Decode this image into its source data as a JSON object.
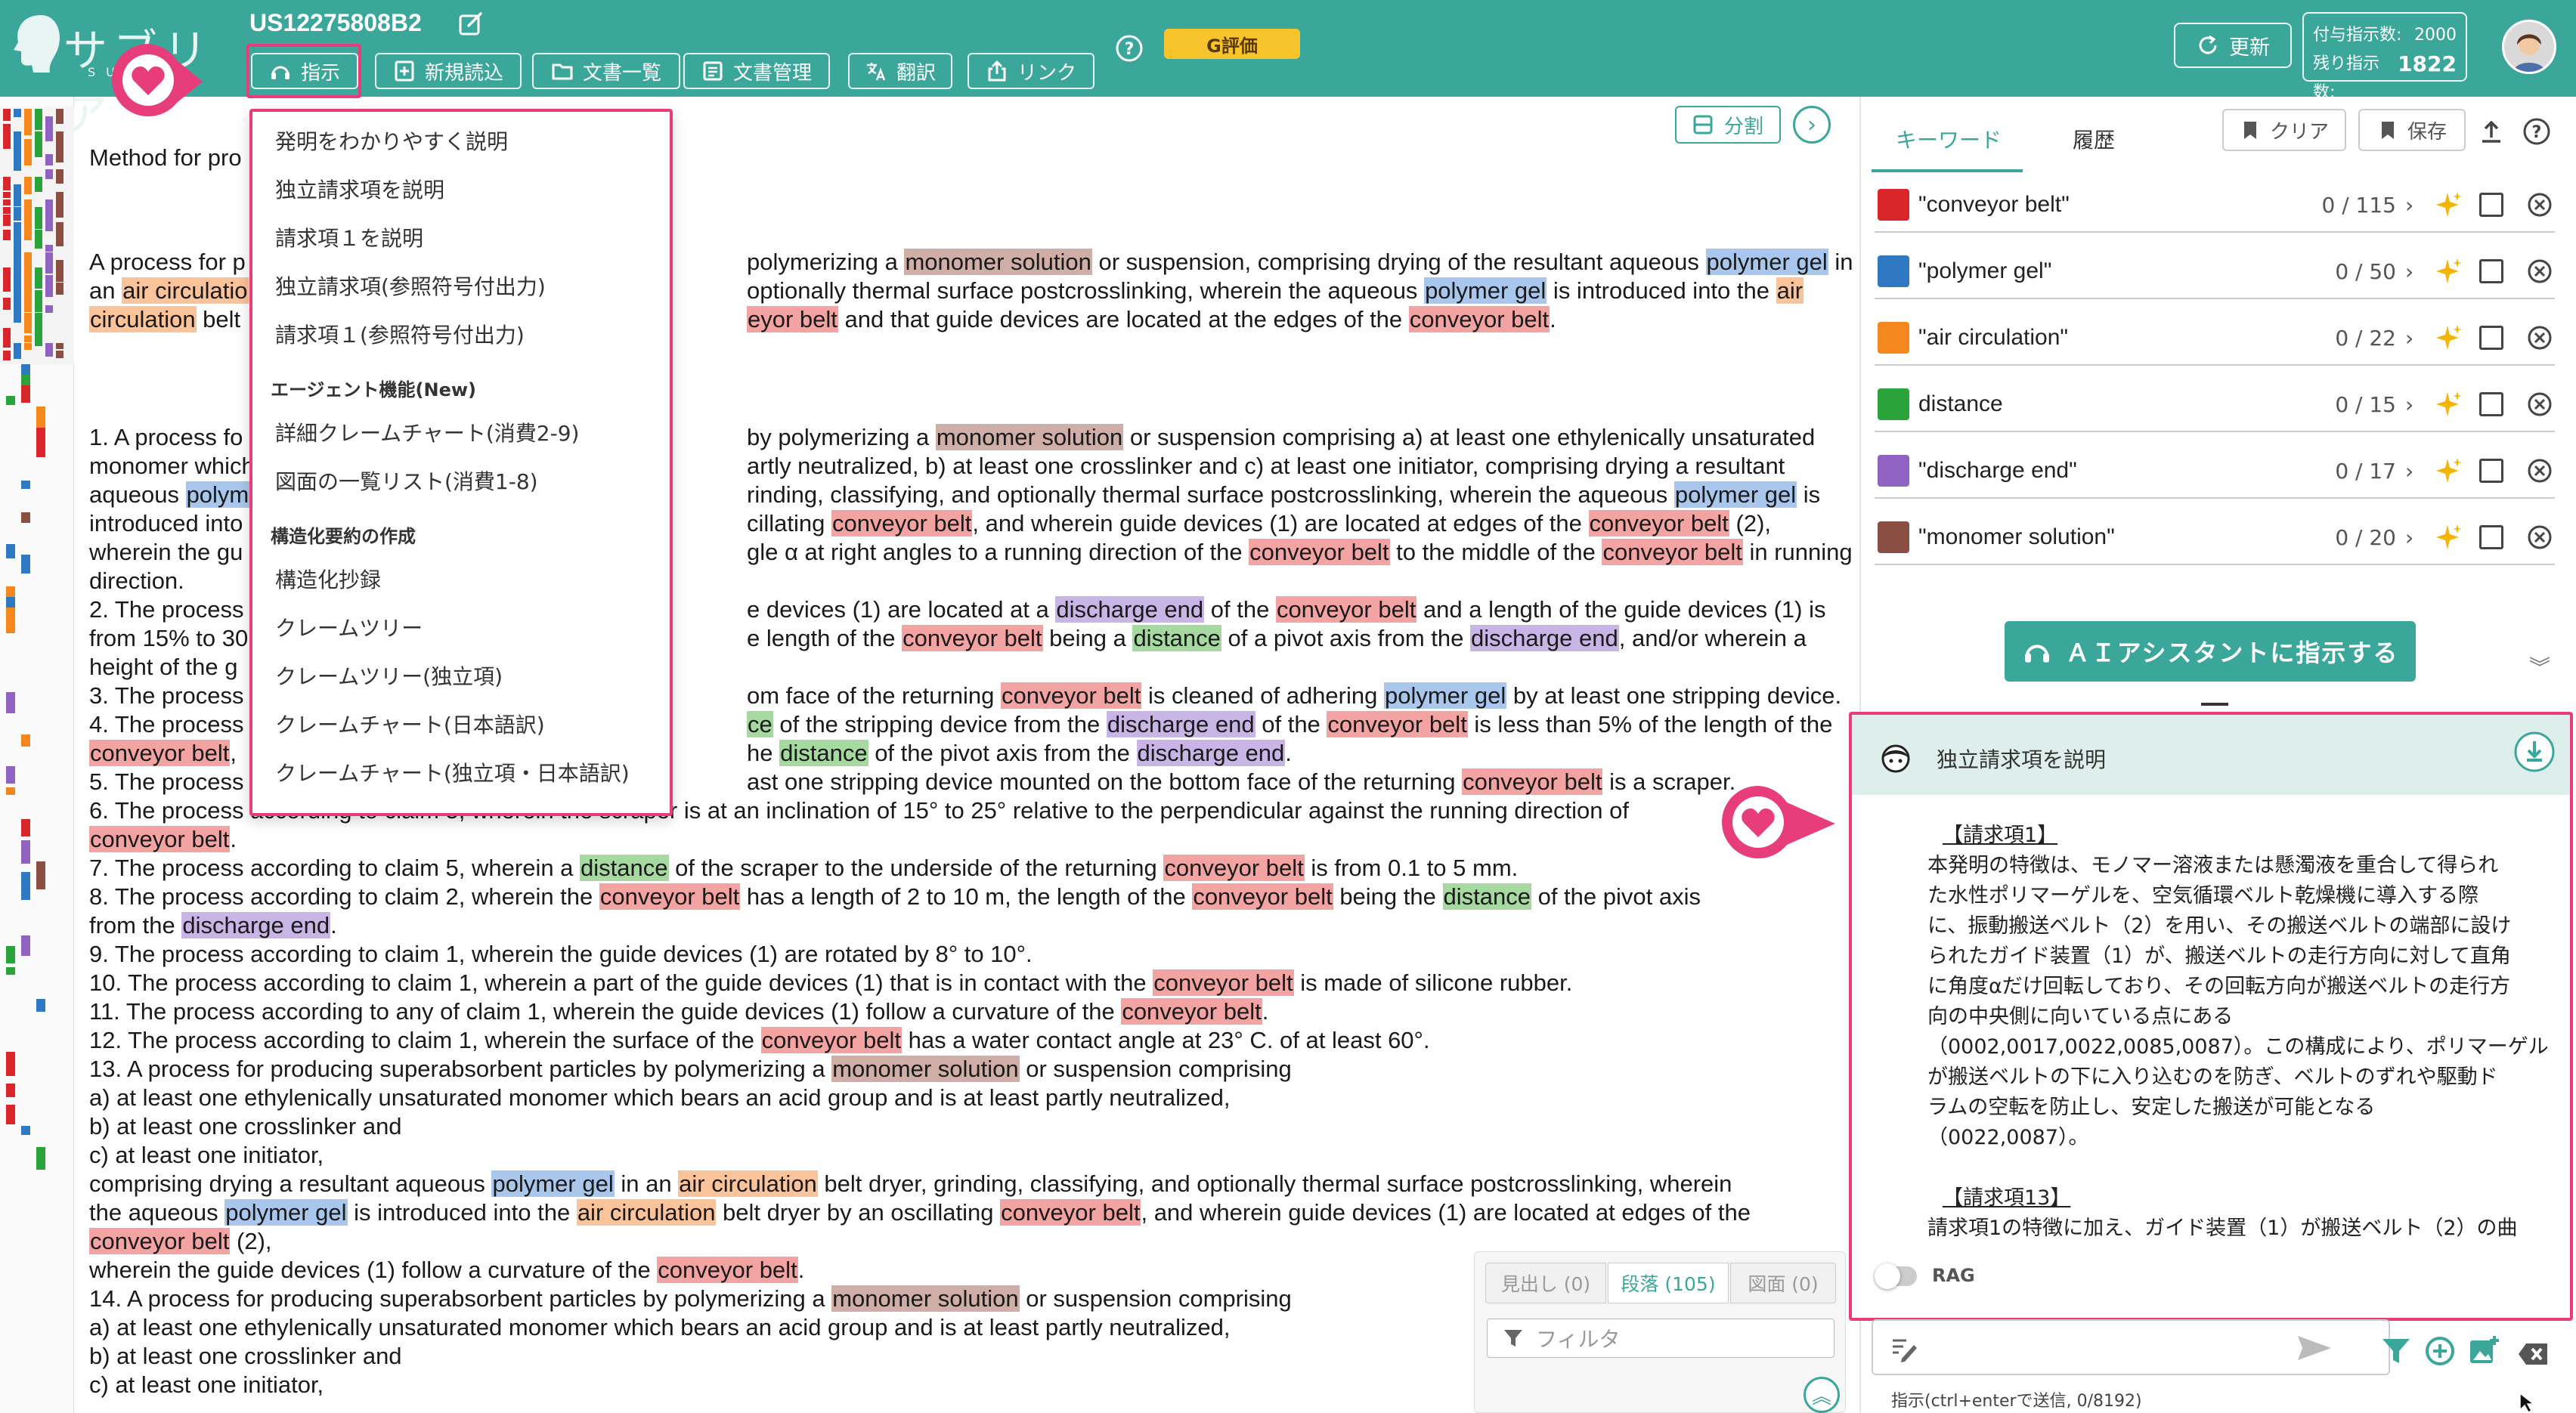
{
  "header": {
    "logo_text": "サブリア",
    "logo_sub": "SUBLIA",
    "doc_id": "US12275808B2",
    "buttons": [
      {
        "label": "指示",
        "icon": "assistant-icon"
      },
      {
        "label": "新規読込",
        "icon": "add-document-icon"
      },
      {
        "label": "文書一覧",
        "icon": "folder-icon"
      },
      {
        "label": "文書管理",
        "icon": "manage-icon"
      },
      {
        "label": "翻訳",
        "icon": "translate-icon"
      },
      {
        "label": "リンク",
        "icon": "share-icon"
      }
    ],
    "eval_badge": "G評価",
    "refresh_label": "更新",
    "quota_granted_label": "付与指示数:",
    "quota_granted": "2000",
    "quota_remaining_label": "残り指示数:",
    "quota_remaining": "1822"
  },
  "dropdown": {
    "items": [
      "発明をわかりやすく説明",
      "独立請求項を説明",
      "請求項１を説明",
      "独立請求項(参照符号付出力)",
      "請求項１(参照符号付出力)"
    ],
    "agent_header": "エージェント機能(New)",
    "agent_items": [
      "詳細クレームチャート(消費2-9)",
      "図面の一覧リスト(消費1-8)"
    ],
    "struct_header": "構造化要約の作成",
    "struct_items": [
      "構造化抄録",
      "クレームツリー",
      "クレームツリー(独立項)",
      "クレームチャート(日本語訳)",
      "クレームチャート(独立項・日本語訳)"
    ]
  },
  "document": {
    "split_label": "分割",
    "lines": [
      [
        {
          "t": "Method for pro"
        }
      ],
      [
        {
          "t": "A process for p"
        },
        {
          "gap": true
        },
        {
          "t": "polymerizing a "
        },
        {
          "t": "monomer solution",
          "k": "brown"
        },
        {
          "t": " or suspension, comprising drying of the resultant aqueous "
        },
        {
          "t": "polymer gel",
          "k": "blue"
        },
        {
          "t": " in"
        }
      ],
      [
        {
          "t": "an "
        },
        {
          "t": "air circulatio",
          "k": "orange"
        },
        {
          "gap": true
        },
        {
          "t": "optionally thermal surface postcrosslinking, wherein the aqueous "
        },
        {
          "t": "polymer gel",
          "k": "blue"
        },
        {
          "t": " is introduced into the "
        },
        {
          "t": "air",
          "k": "orange"
        }
      ],
      [
        {
          "t": "circulation",
          "k": "orange"
        },
        {
          "t": " belt"
        },
        {
          "gap": true
        },
        {
          "t": "eyor belt",
          "k": "red"
        },
        {
          "t": " and that guide devices are located at the edges of the "
        },
        {
          "t": "conveyor belt",
          "k": "red"
        },
        {
          "t": "."
        }
      ],
      [
        {
          "t": "1. A process fo"
        },
        {
          "gap": true
        },
        {
          "t": "by polymerizing a "
        },
        {
          "t": "monomer solution",
          "k": "brown"
        },
        {
          "t": " or suspension comprising a) at least one ethylenically unsaturated"
        }
      ],
      [
        {
          "t": "monomer which"
        },
        {
          "gap": true
        },
        {
          "t": "artly neutralized, b) at least one crosslinker and c) at least one initiator, comprising drying a resultant"
        }
      ],
      [
        {
          "t": "aqueous "
        },
        {
          "t": "polym",
          "k": "blue"
        },
        {
          "gap": true
        },
        {
          "t": "rinding, classifying, and optionally thermal surface postcrosslinking, wherein the aqueous "
        },
        {
          "t": "polymer gel",
          "k": "blue"
        },
        {
          "t": " is"
        }
      ],
      [
        {
          "t": "introduced into"
        },
        {
          "gap": true
        },
        {
          "t": "cillating "
        },
        {
          "t": "conveyor belt",
          "k": "red"
        },
        {
          "t": ", and wherein guide devices (1) are located at edges of the "
        },
        {
          "t": "conveyor belt",
          "k": "red"
        },
        {
          "t": " (2),"
        }
      ],
      [
        {
          "t": "wherein the gu"
        },
        {
          "gap": true
        },
        {
          "t": "gle α at right angles to a running direction of the "
        },
        {
          "t": "conveyor belt",
          "k": "red"
        },
        {
          "t": " to the middle of the "
        },
        {
          "t": "conveyor belt",
          "k": "red"
        },
        {
          "t": " in running"
        }
      ],
      [
        {
          "t": "direction."
        }
      ],
      [
        {
          "t": "2. The process"
        },
        {
          "gap": true
        },
        {
          "t": "e devices (1) are located at a "
        },
        {
          "t": "discharge end",
          "k": "purple"
        },
        {
          "t": " of the "
        },
        {
          "t": "conveyor belt",
          "k": "red"
        },
        {
          "t": " and a length of the guide devices (1) is"
        }
      ],
      [
        {
          "t": "from 15% to 30"
        },
        {
          "gap": true
        },
        {
          "t": "e length of the "
        },
        {
          "t": "conveyor belt",
          "k": "red"
        },
        {
          "t": " being a "
        },
        {
          "t": "distance",
          "k": "green"
        },
        {
          "t": " of a pivot axis from the "
        },
        {
          "t": "discharge end",
          "k": "purple"
        },
        {
          "t": ", and/or wherein a"
        }
      ],
      [
        {
          "t": "height of the g"
        }
      ],
      [
        {
          "t": "3. The process"
        },
        {
          "gap": true
        },
        {
          "t": "om face of the returning "
        },
        {
          "t": "conveyor belt",
          "k": "red"
        },
        {
          "t": " is cleaned of adhering "
        },
        {
          "t": "polymer gel",
          "k": "blue"
        },
        {
          "t": " by at least one stripping device."
        }
      ],
      [
        {
          "t": "4. The process"
        },
        {
          "gap": true
        },
        {
          "t": "ce",
          "k": "green"
        },
        {
          "t": " of the stripping device from the "
        },
        {
          "t": "discharge end",
          "k": "purple"
        },
        {
          "t": " of the "
        },
        {
          "t": "conveyor belt",
          "k": "red"
        },
        {
          "t": " is less than 5% of the length of the"
        }
      ],
      [
        {
          "t": "conveyor belt",
          "k": "red"
        },
        {
          "t": ","
        },
        {
          "gap": true
        },
        {
          "t": "he "
        },
        {
          "t": "distance",
          "k": "green"
        },
        {
          "t": " of the pivot axis from the "
        },
        {
          "t": "discharge end",
          "k": "purple"
        },
        {
          "t": "."
        }
      ],
      [
        {
          "t": "5. The process"
        },
        {
          "gap": true
        },
        {
          "t": "ast one stripping device mounted on the bottom face of the returning "
        },
        {
          "t": "conveyor belt",
          "k": "red"
        },
        {
          "t": " is a scraper."
        }
      ],
      [
        {
          "t": "6. The process according to claim 5, wherein the scraper is at an inclination of 15° to 25° relative to the perpendicular against the running direction of"
        }
      ],
      [
        {
          "t": "conveyor belt",
          "k": "red"
        },
        {
          "t": "."
        }
      ],
      [
        {
          "t": "7. The process according to claim 5, wherein a "
        },
        {
          "t": "distance",
          "k": "green"
        },
        {
          "t": " of the scraper to the underside of the returning "
        },
        {
          "t": "conveyor belt",
          "k": "red"
        },
        {
          "t": " is from 0.1 to 5 mm."
        }
      ],
      [
        {
          "t": "8. The process according to claim 2, wherein the "
        },
        {
          "t": "conveyor belt",
          "k": "red"
        },
        {
          "t": " has a length of 2 to 10 m, the length of the "
        },
        {
          "t": "conveyor belt",
          "k": "red"
        },
        {
          "t": " being the "
        },
        {
          "t": "distance",
          "k": "green"
        },
        {
          "t": " of the pivot axis"
        }
      ],
      [
        {
          "t": "from the "
        },
        {
          "t": "discharge end",
          "k": "purple"
        },
        {
          "t": "."
        }
      ],
      [
        {
          "t": "9. The process according to claim 1, wherein the guide devices (1) are rotated by 8° to 10°."
        }
      ],
      [
        {
          "t": "10. The process according to claim 1, wherein a part of the guide devices (1) that is in contact with the "
        },
        {
          "t": "conveyor belt",
          "k": "red"
        },
        {
          "t": " is made of silicone rubber."
        }
      ],
      [
        {
          "t": "11. The process according to any of claim 1, wherein the guide devices (1) follow a curvature of the "
        },
        {
          "t": "conveyor belt",
          "k": "red"
        },
        {
          "t": "."
        }
      ],
      [
        {
          "t": "12. The process according to claim 1, wherein the surface of the "
        },
        {
          "t": "conveyor belt",
          "k": "red"
        },
        {
          "t": " has a water contact angle at 23° C. of at least 60°."
        }
      ],
      [
        {
          "t": "13. A process for producing superabsorbent particles by polymerizing a "
        },
        {
          "t": "monomer solution",
          "k": "brown"
        },
        {
          "t": " or suspension comprising"
        }
      ],
      [
        {
          "t": "a) at least one ethylenically unsaturated monomer which bears an acid group and is at least partly neutralized,"
        }
      ],
      [
        {
          "t": "b) at least one crosslinker and"
        }
      ],
      [
        {
          "t": "c) at least one initiator,"
        }
      ],
      [
        {
          "t": "comprising drying a resultant aqueous "
        },
        {
          "t": "polymer gel",
          "k": "blue"
        },
        {
          "t": " in an "
        },
        {
          "t": "air circulation",
          "k": "orange"
        },
        {
          "t": " belt dryer, grinding, classifying, and optionally thermal surface postcrosslinking, wherein"
        }
      ],
      [
        {
          "t": "the aqueous "
        },
        {
          "t": "polymer gel",
          "k": "blue"
        },
        {
          "t": " is introduced into the "
        },
        {
          "t": "air circulation",
          "k": "orange"
        },
        {
          "t": " belt dryer by an oscillating "
        },
        {
          "t": "conveyor belt",
          "k": "red"
        },
        {
          "t": ", and wherein guide devices (1) are located at edges of the"
        }
      ],
      [
        {
          "t": "conveyor belt",
          "k": "red"
        },
        {
          "t": " (2),"
        }
      ],
      [
        {
          "t": "wherein the guide devices (1) follow a curvature of the "
        },
        {
          "t": "conveyor belt",
          "k": "red"
        },
        {
          "t": "."
        }
      ],
      [
        {
          "t": "14. A process for producing superabsorbent particles by polymerizing a "
        },
        {
          "t": "monomer solution",
          "k": "brown"
        },
        {
          "t": " or suspension comprising"
        }
      ],
      [
        {
          "t": "a) at least one ethylenically unsaturated monomer which bears an acid group and is at least partly neutralized,"
        }
      ],
      [
        {
          "t": "b) at least one crosslinker and"
        }
      ],
      [
        {
          "t": "c) at least one initiator,"
        }
      ]
    ]
  },
  "mini_panel": {
    "tabs": [
      "見出し (0)",
      "段落 (105)",
      "図面 (0)"
    ],
    "filter_placeholder": "フィルタ"
  },
  "right_panel": {
    "tabs": [
      "キーワード",
      "履歴"
    ],
    "clear_label": "クリア",
    "save_label": "保存",
    "keywords": [
      {
        "name": "\"conveyor belt\"",
        "count": "0 / 115",
        "color": "#d9262b"
      },
      {
        "name": "\"polymer gel\"",
        "count": "0 / 50",
        "color": "#2f79c2"
      },
      {
        "name": "\"air circulation\"",
        "count": "0 / 22",
        "color": "#f5871f"
      },
      {
        "name": "distance",
        "count": "0 / 15",
        "color": "#2aa43a"
      },
      {
        "name": "\"discharge end\"",
        "count": "0 / 17",
        "color": "#9062c2"
      },
      {
        "name": "\"monomer solution\"",
        "count": "0 / 20",
        "color": "#8a4f42"
      }
    ],
    "ai_button": "ＡＩアシスタントに指示する",
    "answer_title": "独立請求項を説明",
    "answer_lines": [
      {
        "t": "【請求項1】",
        "u": true,
        "indent": true
      },
      {
        "t": "本発明の特徴は、モノマー溶液または懸濁液を重合して得られ"
      },
      {
        "t": "た水性ポリマーゲルを、空気循環ベルト乾燥機に導入する際"
      },
      {
        "t": "に、振動搬送ベルト（2）を用い、その搬送ベルトの端部に設け"
      },
      {
        "t": "られたガイド装置（1）が、搬送ベルトの走行方向に対して直角"
      },
      {
        "t": "に角度αだけ回転しており、その回転方向が搬送ベルトの走行方"
      },
      {
        "t": "向の中央側に向いている点にある"
      },
      {
        "t": "（0002,0017,0022,0085,0087）。この構成により、ポリマーゲル"
      },
      {
        "t": "が搬送ベルトの下に入り込むのを防ぎ、ベルトのずれや駆動ド"
      },
      {
        "t": "ラムの空転を防止し、安定した搬送が可能となる"
      },
      {
        "t": "（0022,0087）。"
      },
      {
        "t": ""
      },
      {
        "t": "【請求項13】",
        "u": true,
        "indent": true
      },
      {
        "t": "請求項1の特徴に加え、ガイド装置（1）が搬送ベルト（2）の曲"
      }
    ],
    "rag_label": "RAG",
    "chat_hint": "指示(ctrl+enterで送信, 0/8192)"
  }
}
